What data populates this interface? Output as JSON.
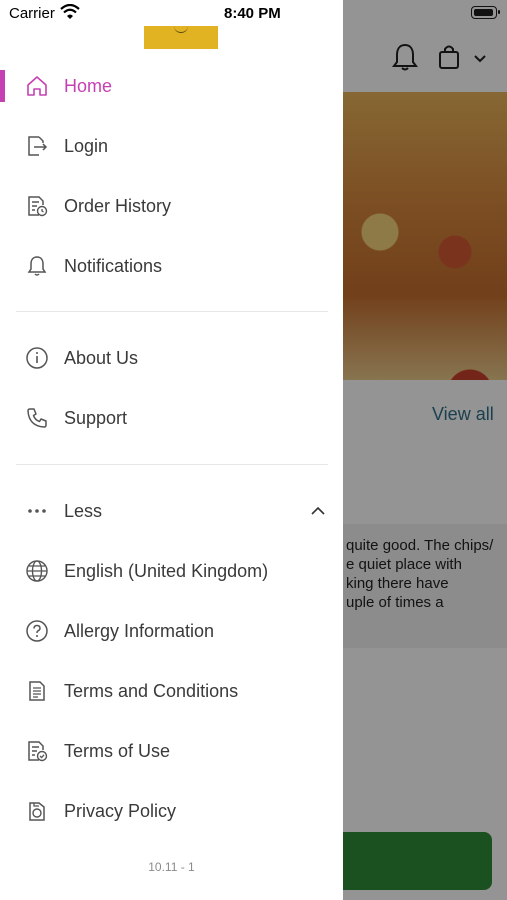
{
  "status_bar": {
    "carrier": "Carrier",
    "time": "8:40 PM"
  },
  "menu": {
    "primary": [
      {
        "label": "Home",
        "icon": "home-icon",
        "active": true
      },
      {
        "label": "Login",
        "icon": "login-icon"
      },
      {
        "label": "Order History",
        "icon": "order-history-icon"
      },
      {
        "label": "Notifications",
        "icon": "bell-icon"
      }
    ],
    "secondary": [
      {
        "label": "About Us",
        "icon": "info-icon"
      },
      {
        "label": "Support",
        "icon": "phone-icon"
      }
    ],
    "more_toggle": {
      "label": "Less",
      "icon": "more-dots-icon"
    },
    "extra": [
      {
        "label": "English (United Kingdom)",
        "icon": "globe-icon"
      },
      {
        "label": "Allergy Information",
        "icon": "question-icon"
      },
      {
        "label": "Terms and Conditions",
        "icon": "document-icon"
      },
      {
        "label": "Terms of Use",
        "icon": "document-check-icon"
      },
      {
        "label": "Privacy Policy",
        "icon": "privacy-icon"
      }
    ],
    "active_color": "#c541b3"
  },
  "version": "10.11 - 1",
  "background": {
    "view_all": "View all",
    "review_text": "quite good.  The chips/\ne quiet place with\nking there have\nuple of times a"
  }
}
